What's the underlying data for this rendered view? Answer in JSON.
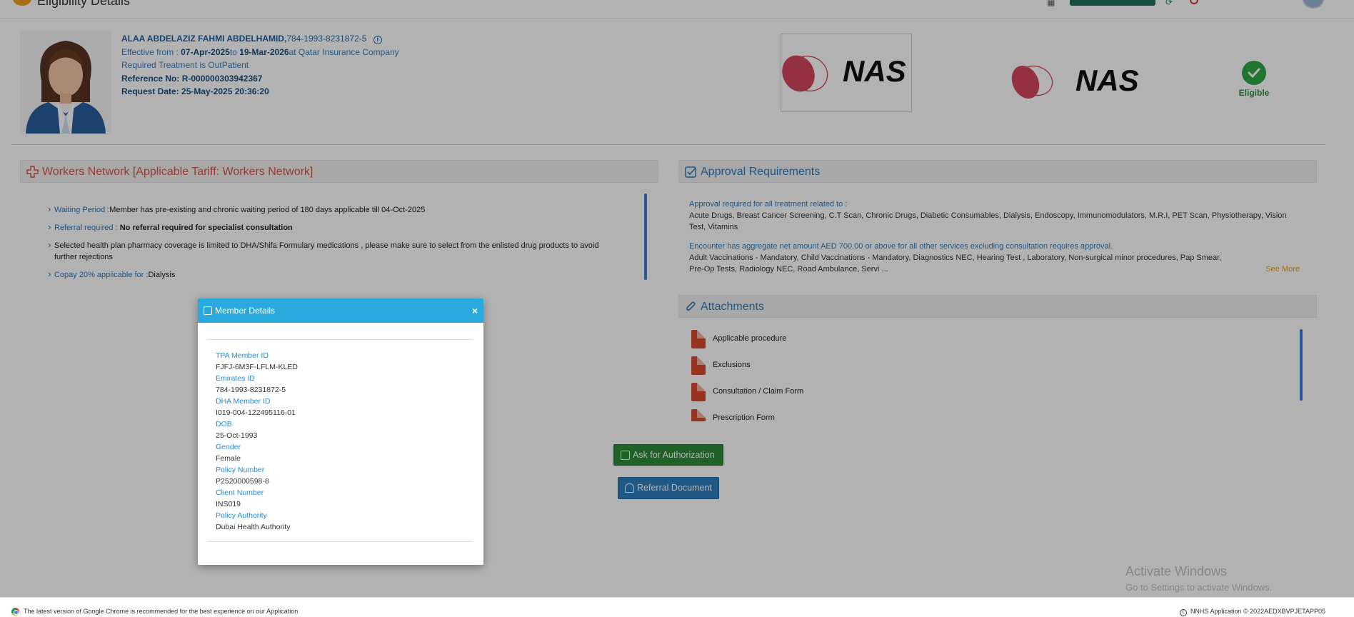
{
  "header": {
    "page_title": "Eligibility Details"
  },
  "member": {
    "name_line": "ALAA ABDELAZIZ FAHMI ABDELHAMID,",
    "eid_line": "784-1993-8231872-5",
    "effective_prefix": "Effective from : ",
    "effective_from": "07-Apr-2025",
    "effective_to_word": "to ",
    "effective_to": "19-Mar-2026",
    "effective_suffix": "at Qatar Insurance Company",
    "treatment": "Required Treatment is OutPatient",
    "reference": "Reference No: R-000000303942367",
    "request_date": "Request Date: 25-May-2025 20:36:20",
    "logo_text": "NAS",
    "logo_text_2": "NAS",
    "eligibility_status": "Eligible"
  },
  "workers": {
    "title": "Workers Network [Applicable Tariff: Workers Network]",
    "items": [
      {
        "label": "Waiting Period :",
        "text": "Member has pre-existing and chronic waiting period of 180 days applicable till 04-Oct-2025"
      },
      {
        "label": "Referral required :",
        "text": "No referral required for specialist consultation"
      },
      {
        "label": "",
        "text": "Selected health plan pharmacy coverage is limited to DHA/Shifa Formulary medications , please make sure to select from the enlisted drug products to avoid further rejections"
      },
      {
        "label": "Copay 20% applicable for :",
        "text": "Dialysis"
      }
    ]
  },
  "approval": {
    "title": "Approval Requirements",
    "block1_title": "Approval required for all treatment related to :",
    "block1_text": "Acute Drugs, Breast Cancer Screening, C.T Scan, Chronic Drugs, Diabetic Consumables, Dialysis, Endoscopy, Immunomodulators, M.R.I, PET Scan, Physiotherapy, Vision Test, Vitamins",
    "block2_title": "Encounter has aggregate net amount AED 700.00 or above for all other services excluding consultation requires approval.",
    "block2_text": "Adult Vaccinations - Mandatory, Child Vaccinations - Mandatory, Diagnostics NEC, Hearing Test , Laboratory, Non-surgical minor procedures, Pap Smear, Pre-Op Tests, Radiology NEC, Road Ambulance, Servi ...",
    "see_more": "See More"
  },
  "attachments": {
    "title": "Attachments",
    "items": [
      {
        "label": "Applicable procedure"
      },
      {
        "label": "Exclusions"
      },
      {
        "label": "Consultation / Claim Form"
      },
      {
        "label": "Prescription Form"
      }
    ]
  },
  "actions": {
    "ask_auth": "Ask for Authorization",
    "referral_doc": "Referral Document"
  },
  "modal": {
    "title": "Member Details",
    "close": "×",
    "fields": [
      {
        "label": "TPA Member ID",
        "value": "FJFJ-6M3F-LFLM-KLED"
      },
      {
        "label": "Emirates ID",
        "value": "784-1993-8231872-5"
      },
      {
        "label": "DHA Member ID",
        "value": "I019-004-122495116-01"
      },
      {
        "label": "DOB",
        "value": "25-Oct-1993"
      },
      {
        "label": "Gender",
        "value": "Female"
      },
      {
        "label": "Policy Number",
        "value": "P2520000598-8"
      },
      {
        "label": "Client Number",
        "value": "INS019"
      },
      {
        "label": "Policy Authority",
        "value": "Dubai Health Authority"
      }
    ]
  },
  "footer": {
    "left": "The latest version of Google Chrome is recommended for the best experience on our Application",
    "right": "NNHS Application © 2022AEDXBVPJETAPP05"
  },
  "watermark": {
    "title": "Activate Windows",
    "sub": "Go to Settings to activate Windows."
  },
  "colors": {
    "modal_header": "#29a9de",
    "accent_blue": "#2b7bbf",
    "workers_red": "#d9534f",
    "auth_green": "#2e8b38",
    "eligible_green": "#2eaa45",
    "see_more_orange": "#e8a020"
  }
}
